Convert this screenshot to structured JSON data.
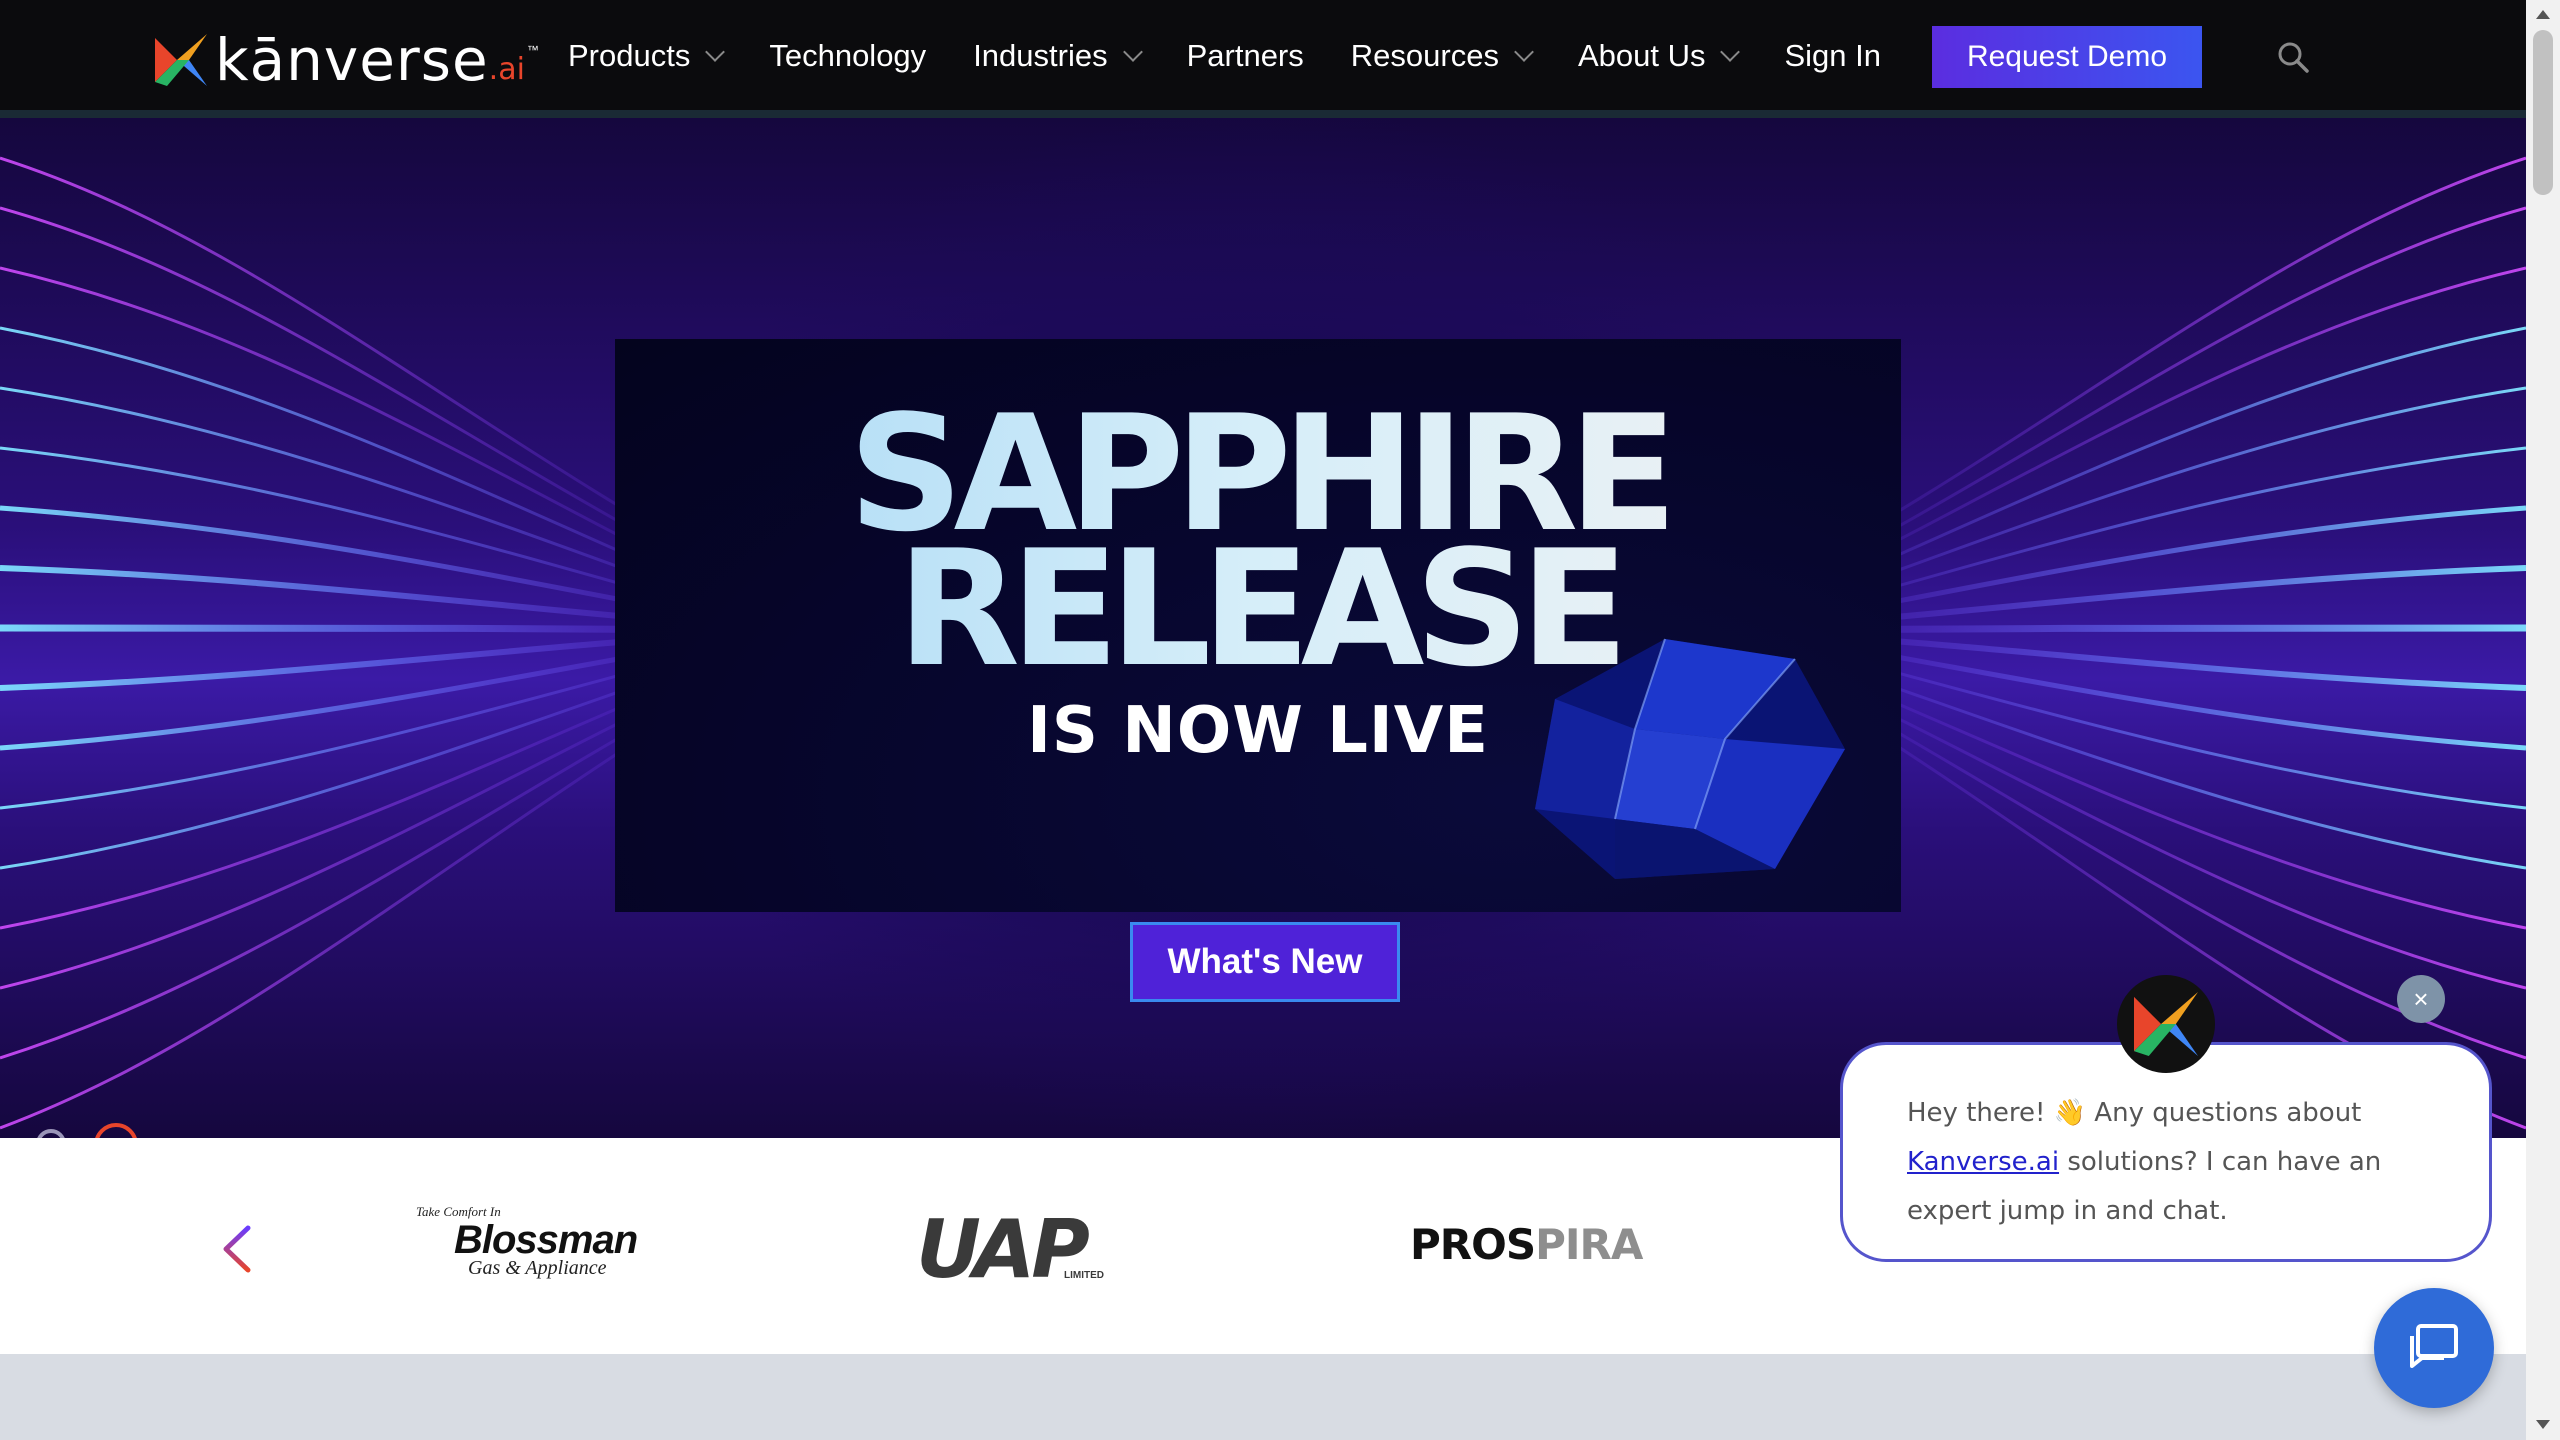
{
  "nav": {
    "logo_text": "kānverse",
    "logo_suffix": ".ai",
    "logo_tm": "™",
    "items": [
      {
        "label": "Products",
        "dropdown": true
      },
      {
        "label": "Technology",
        "dropdown": false
      },
      {
        "label": "Industries",
        "dropdown": true
      },
      {
        "label": "Partners",
        "dropdown": false
      },
      {
        "label": "Resources",
        "dropdown": true
      },
      {
        "label": "About Us",
        "dropdown": true
      },
      {
        "label": "Sign In",
        "dropdown": false
      }
    ],
    "cta_label": "Request Demo",
    "search_icon": "search-icon"
  },
  "hero": {
    "banner_line1": "SAPPHIRE",
    "banner_line2": "RELEASE",
    "banner_line3": "IS NOW LIVE",
    "button_label": "What's New",
    "slides_count": 2,
    "active_slide": 2
  },
  "clients": {
    "blossman_tag": "Take Comfort In",
    "blossman_name": "Blossman",
    "blossman_sub": "Gas & Appliance",
    "uap_name": "UAP",
    "uap_sub": "LIMITED",
    "prospira_a": "PROS",
    "prospira_b": "PIRA"
  },
  "chat": {
    "greeting_before": "Hey there! 👋 Any questions about",
    "link_text": "Kanverse.ai",
    "greeting_after": "solutions? I can have an expert jump in and chat.",
    "close_label": "×"
  },
  "colors": {
    "nav_bg": "#0b0b0d",
    "accent_orange": "#e8452b",
    "cta_purple": "#5b2de0",
    "chat_blue": "#2f6bd8"
  }
}
